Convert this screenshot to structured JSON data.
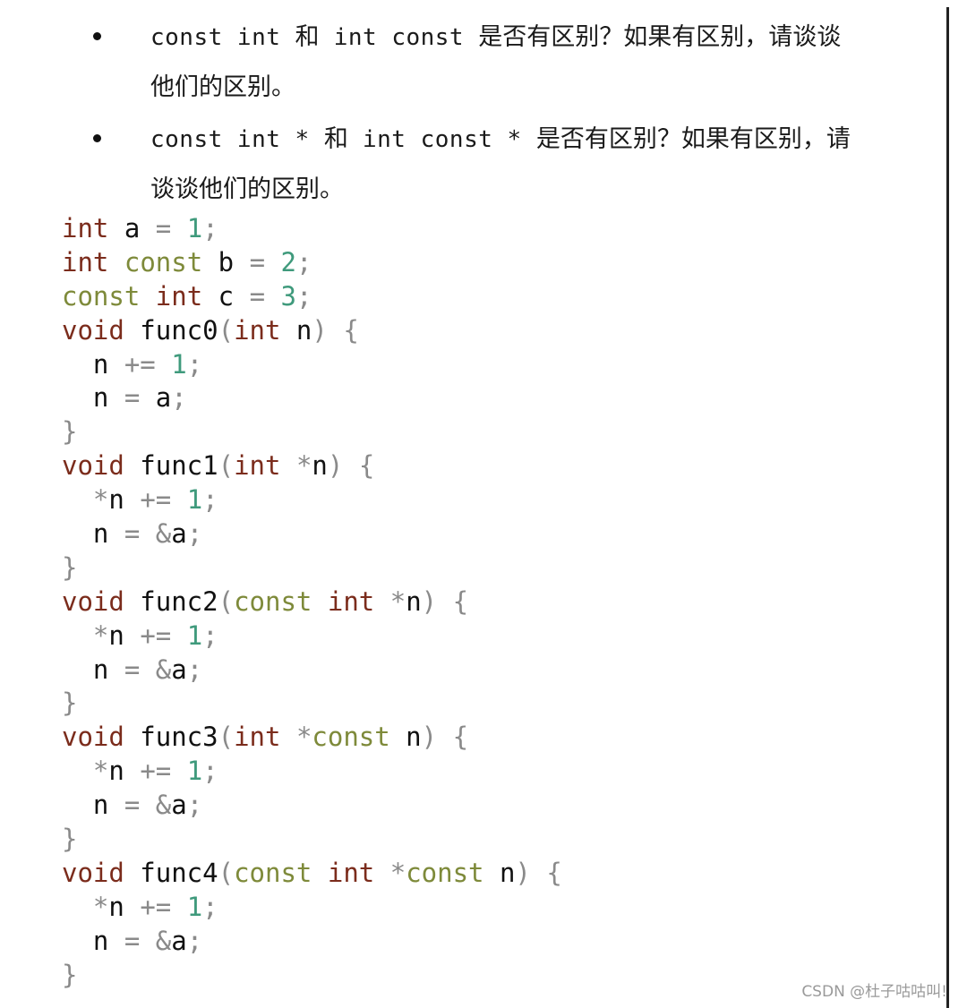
{
  "bullets": [
    {
      "lines": [
        [
          {
            "t": "const int ",
            "k": "mono"
          },
          {
            "t": "和",
            "k": "cjk"
          },
          {
            "t": " int const ",
            "k": "mono"
          },
          {
            "t": "是否有区别？如果有区别，请谈谈",
            "k": "cjk"
          }
        ],
        [
          {
            "t": "他们的区别。",
            "k": "cjk"
          }
        ]
      ]
    },
    {
      "lines": [
        [
          {
            "t": "const int * ",
            "k": "mono"
          },
          {
            "t": "和",
            "k": "cjk"
          },
          {
            "t": " int const * ",
            "k": "mono"
          },
          {
            "t": "是否有区别？如果有区别，请",
            "k": "cjk"
          }
        ],
        [
          {
            "t": "谈谈他们的区别。",
            "k": "cjk"
          }
        ]
      ]
    }
  ],
  "code": {
    "language": "c",
    "colors": {
      "keyword": "#7b2c1c",
      "const": "#7e8a3a",
      "number": "#3f9a7c",
      "punctuation": "#8a8a8a",
      "identifier": "#111111"
    },
    "lines": [
      [
        [
          "kw",
          "int"
        ],
        [
          "id",
          " a "
        ],
        [
          "punc",
          "="
        ],
        [
          "id",
          " "
        ],
        [
          "num",
          "1"
        ],
        [
          "punc",
          ";"
        ]
      ],
      [
        [
          "kw",
          "int"
        ],
        [
          "id",
          " "
        ],
        [
          "const",
          "const"
        ],
        [
          "id",
          " b "
        ],
        [
          "punc",
          "="
        ],
        [
          "id",
          " "
        ],
        [
          "num",
          "2"
        ],
        [
          "punc",
          ";"
        ]
      ],
      [
        [
          "const",
          "const"
        ],
        [
          "id",
          " "
        ],
        [
          "kw",
          "int"
        ],
        [
          "id",
          " c "
        ],
        [
          "punc",
          "="
        ],
        [
          "id",
          " "
        ],
        [
          "num",
          "3"
        ],
        [
          "punc",
          ";"
        ]
      ],
      [
        [
          "kw",
          "void"
        ],
        [
          "id",
          " func0"
        ],
        [
          "punc",
          "("
        ],
        [
          "kw",
          "int"
        ],
        [
          "id",
          " n"
        ],
        [
          "punc",
          ")"
        ],
        [
          "id",
          " "
        ],
        [
          "punc",
          "{"
        ]
      ],
      [
        [
          "id",
          "  n "
        ],
        [
          "punc",
          "+="
        ],
        [
          "id",
          " "
        ],
        [
          "num",
          "1"
        ],
        [
          "punc",
          ";"
        ]
      ],
      [
        [
          "id",
          "  n "
        ],
        [
          "punc",
          "="
        ],
        [
          "id",
          " a"
        ],
        [
          "punc",
          ";"
        ]
      ],
      [
        [
          "punc",
          "}"
        ]
      ],
      [
        [
          "kw",
          "void"
        ],
        [
          "id",
          " func1"
        ],
        [
          "punc",
          "("
        ],
        [
          "kw",
          "int"
        ],
        [
          "id",
          " "
        ],
        [
          "punc",
          "*"
        ],
        [
          "id",
          "n"
        ],
        [
          "punc",
          ")"
        ],
        [
          "id",
          " "
        ],
        [
          "punc",
          "{"
        ]
      ],
      [
        [
          "id",
          "  "
        ],
        [
          "punc",
          "*"
        ],
        [
          "id",
          "n "
        ],
        [
          "punc",
          "+="
        ],
        [
          "id",
          " "
        ],
        [
          "num",
          "1"
        ],
        [
          "punc",
          ";"
        ]
      ],
      [
        [
          "id",
          "  n "
        ],
        [
          "punc",
          "="
        ],
        [
          "id",
          " "
        ],
        [
          "punc",
          "&"
        ],
        [
          "id",
          "a"
        ],
        [
          "punc",
          ";"
        ]
      ],
      [
        [
          "punc",
          "}"
        ]
      ],
      [
        [
          "kw",
          "void"
        ],
        [
          "id",
          " func2"
        ],
        [
          "punc",
          "("
        ],
        [
          "const",
          "const"
        ],
        [
          "id",
          " "
        ],
        [
          "kw",
          "int"
        ],
        [
          "id",
          " "
        ],
        [
          "punc",
          "*"
        ],
        [
          "id",
          "n"
        ],
        [
          "punc",
          ")"
        ],
        [
          "id",
          " "
        ],
        [
          "punc",
          "{"
        ]
      ],
      [
        [
          "id",
          "  "
        ],
        [
          "punc",
          "*"
        ],
        [
          "id",
          "n "
        ],
        [
          "punc",
          "+="
        ],
        [
          "id",
          " "
        ],
        [
          "num",
          "1"
        ],
        [
          "punc",
          ";"
        ]
      ],
      [
        [
          "id",
          "  n "
        ],
        [
          "punc",
          "="
        ],
        [
          "id",
          " "
        ],
        [
          "punc",
          "&"
        ],
        [
          "id",
          "a"
        ],
        [
          "punc",
          ";"
        ]
      ],
      [
        [
          "punc",
          "}"
        ]
      ],
      [
        [
          "kw",
          "void"
        ],
        [
          "id",
          " func3"
        ],
        [
          "punc",
          "("
        ],
        [
          "kw",
          "int"
        ],
        [
          "id",
          " "
        ],
        [
          "punc",
          "*"
        ],
        [
          "const",
          "const"
        ],
        [
          "id",
          " n"
        ],
        [
          "punc",
          ")"
        ],
        [
          "id",
          " "
        ],
        [
          "punc",
          "{"
        ]
      ],
      [
        [
          "id",
          "  "
        ],
        [
          "punc",
          "*"
        ],
        [
          "id",
          "n "
        ],
        [
          "punc",
          "+="
        ],
        [
          "id",
          " "
        ],
        [
          "num",
          "1"
        ],
        [
          "punc",
          ";"
        ]
      ],
      [
        [
          "id",
          "  n "
        ],
        [
          "punc",
          "="
        ],
        [
          "id",
          " "
        ],
        [
          "punc",
          "&"
        ],
        [
          "id",
          "a"
        ],
        [
          "punc",
          ";"
        ]
      ],
      [
        [
          "punc",
          "}"
        ]
      ],
      [
        [
          "kw",
          "void"
        ],
        [
          "id",
          " func4"
        ],
        [
          "punc",
          "("
        ],
        [
          "const",
          "const"
        ],
        [
          "id",
          " "
        ],
        [
          "kw",
          "int"
        ],
        [
          "id",
          " "
        ],
        [
          "punc",
          "*"
        ],
        [
          "const",
          "const"
        ],
        [
          "id",
          " n"
        ],
        [
          "punc",
          ")"
        ],
        [
          "id",
          " "
        ],
        [
          "punc",
          "{"
        ]
      ],
      [
        [
          "id",
          "  "
        ],
        [
          "punc",
          "*"
        ],
        [
          "id",
          "n "
        ],
        [
          "punc",
          "+="
        ],
        [
          "id",
          " "
        ],
        [
          "num",
          "1"
        ],
        [
          "punc",
          ";"
        ]
      ],
      [
        [
          "id",
          "  n "
        ],
        [
          "punc",
          "="
        ],
        [
          "id",
          " "
        ],
        [
          "punc",
          "&"
        ],
        [
          "id",
          "a"
        ],
        [
          "punc",
          ";"
        ]
      ],
      [
        [
          "punc",
          "}"
        ]
      ]
    ]
  },
  "watermark": "CSDN @杜子咕咕叫!"
}
